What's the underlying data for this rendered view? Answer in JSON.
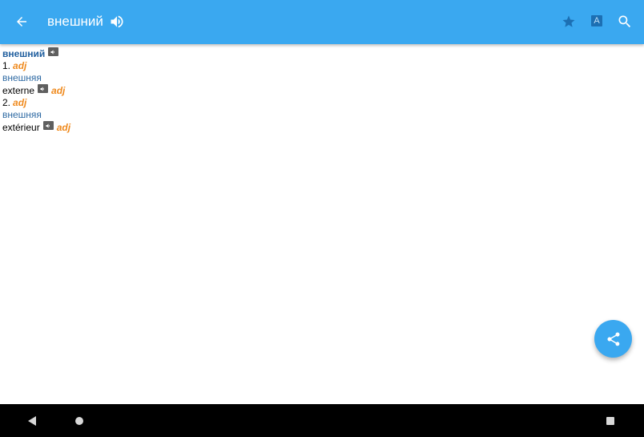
{
  "appbar": {
    "title": "внешний",
    "icons": {
      "back": "arrow-back-icon",
      "speak": "volume-icon",
      "favorite": "star-icon",
      "font": "font-size-icon",
      "search": "search-icon"
    },
    "font_glyph": "A"
  },
  "entry": {
    "headword": "внешний",
    "senses": [
      {
        "number": "1.",
        "pos": "adj",
        "form": "внешняя",
        "translation": "externe",
        "translation_pos": "adj"
      },
      {
        "number": "2.",
        "pos": "adj",
        "form": "внешняя",
        "translation": "extérieur",
        "translation_pos": "adj"
      }
    ]
  },
  "fab": {
    "icon": "share-icon"
  },
  "navbar": {
    "icons": [
      "nav-back-icon",
      "nav-home-icon",
      "nav-recents-icon"
    ]
  },
  "colors": {
    "primary": "#3aa8f0",
    "headword": "#1f5e9e",
    "pos": "#ef8a1e",
    "russian_form": "#2f6aa3"
  }
}
